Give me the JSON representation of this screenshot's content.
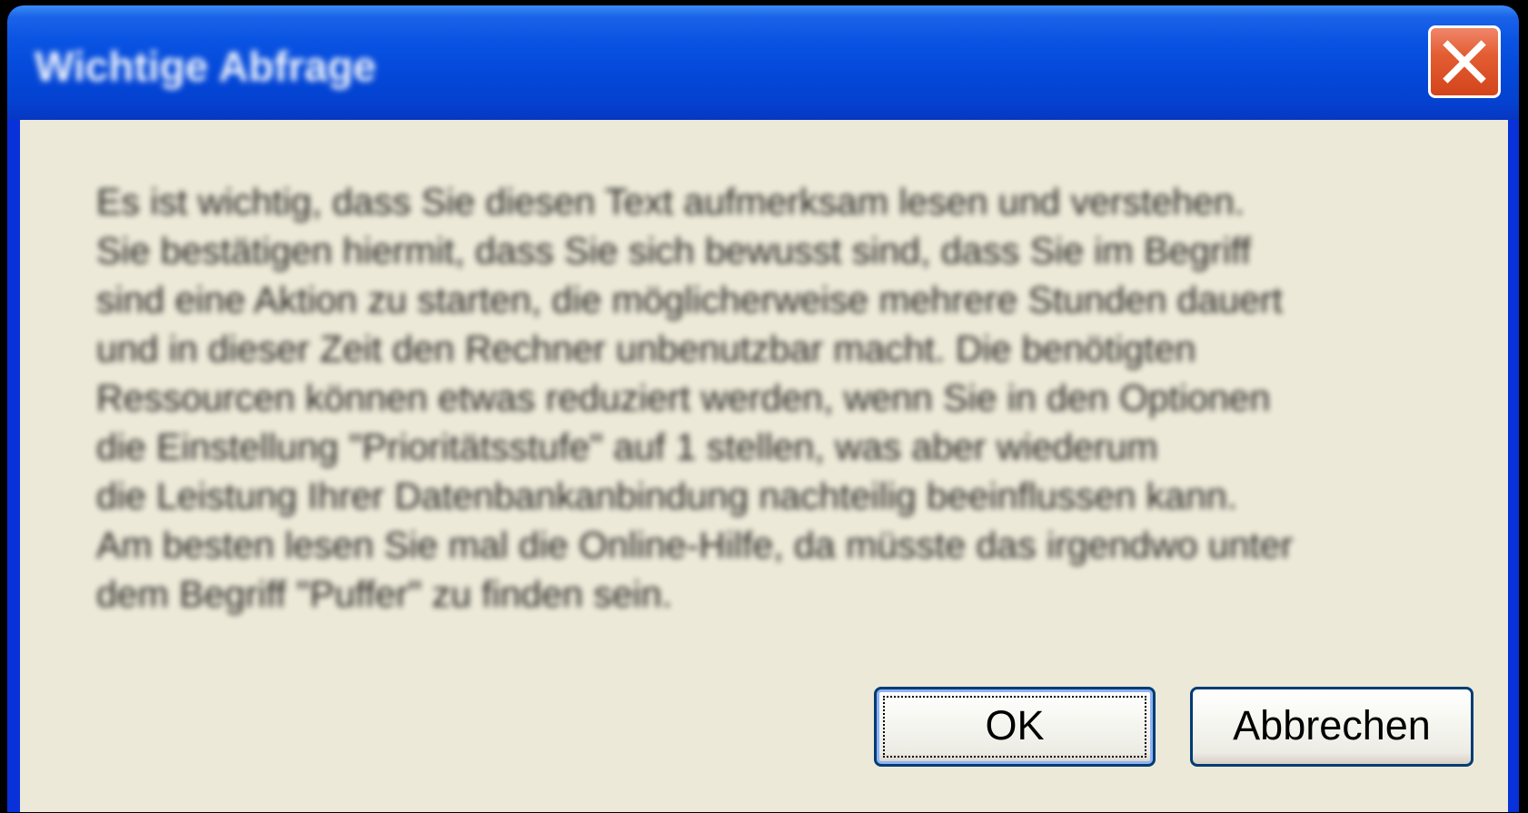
{
  "dialog": {
    "title": "Wichtige Abfrage",
    "message_lines": [
      "Es ist wichtig, dass Sie diesen Text aufmerksam lesen und verstehen.",
      "Sie bestätigen hiermit, dass Sie sich bewusst sind, dass Sie im Begriff",
      "sind eine Aktion zu starten, die möglicherweise mehrere Stunden dauert",
      "und in dieser Zeit den Rechner unbenutzbar macht. Die benötigten",
      "Ressourcen können etwas reduziert werden, wenn Sie in den Optionen",
      "die Einstellung \"Prioritätsstufe\" auf 1 stellen, was aber wiederum",
      "die Leistung Ihrer Datenbankanbindung nachteilig beeinflussen kann.",
      "Am besten lesen Sie mal die Online-Hilfe, da müsste das irgendwo unter",
      "dem Begriff \"Puffer\" zu finden sein."
    ],
    "buttons": {
      "ok_label": "OK",
      "cancel_label": "Abbrechen"
    }
  },
  "icons": {
    "close": "close-icon"
  },
  "colors": {
    "titlebar": "#0a54e3",
    "window_frame": "#0831d9",
    "client_background": "#ece9d8",
    "close_button": "#e35d33",
    "button_border": "#003c74"
  }
}
